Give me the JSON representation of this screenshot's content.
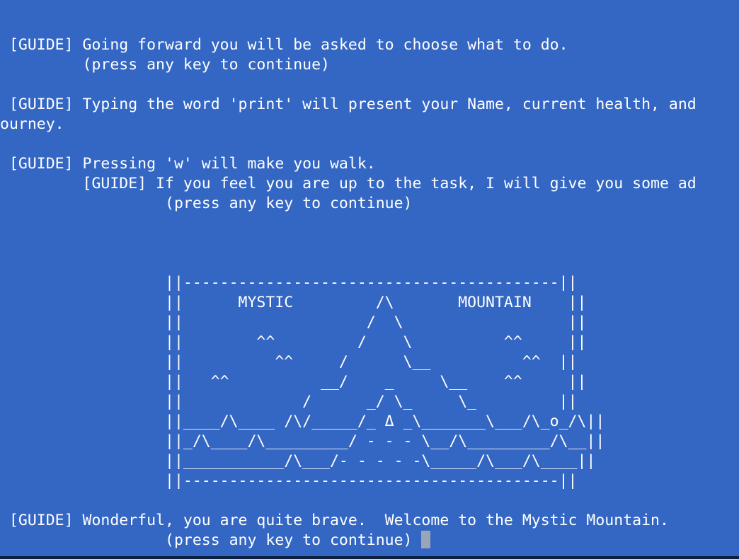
{
  "terminal": {
    "lines": [
      "",
      " [GUIDE] Going forward you will be asked to choose what to do.",
      "         (press any key to continue)",
      "",
      " [GUIDE] Typing the word 'print' will present your Name, current health, and",
      "ourney.",
      "",
      " [GUIDE] Pressing 'w' will make you walk.",
      "         [GUIDE] If you feel you are up to the task, I will give you some ad",
      "                  (press any key to continue)",
      "",
      "",
      "",
      "                  ||-----------------------------------------||",
      "                  ||      MYSTIC         /\\       MOUNTAIN    ||",
      "                  ||                    /  \\                  ||",
      "                  ||        ^^         /    \\          ^^     ||",
      "                  ||          ^^     /      \\__          ^^  ||",
      "                  ||   ^^          __/    _     \\__    ^^     ||",
      "                  ||             /      _/ \\_     \\_         ||",
      "                  ||____/\\____ /\\/_____/_ Δ _\\_______\\___/\\_o_/\\||",
      "                  ||_/\\____/\\_________/ - - - \\__/\\_________/\\__||",
      "                  ||___________/\\___/- - - - -\\_____/\\___/\\____||",
      "                  ||-----------------------------------------||",
      "",
      " [GUIDE] Wonderful, you are quite brave.  Welcome to the Mystic Mountain.",
      "                  (press any key to continue) "
    ]
  }
}
